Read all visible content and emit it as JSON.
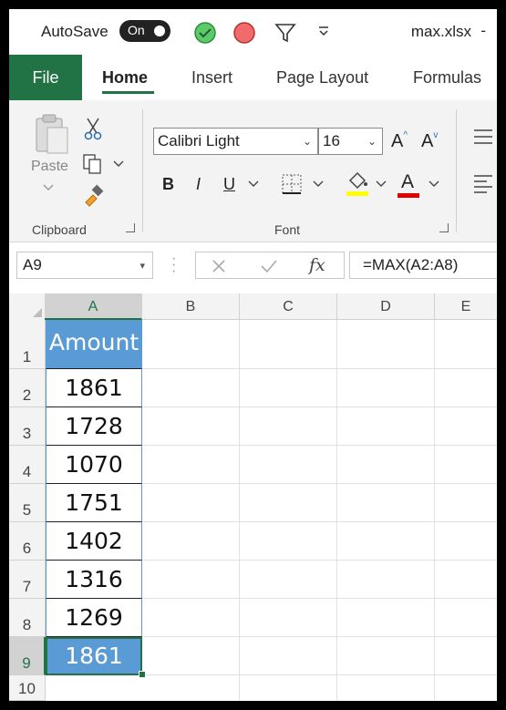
{
  "titlebar": {
    "autosave_label": "AutoSave",
    "autosave_state": "On",
    "filename": "max.xlsx",
    "dash": "-",
    "icons": [
      "check-circle-icon",
      "red-circle-icon",
      "filter-icon",
      "customize-caret-icon"
    ]
  },
  "tabs": [
    {
      "label": "File"
    },
    {
      "label": "Home"
    },
    {
      "label": "Insert"
    },
    {
      "label": "Page Layout"
    },
    {
      "label": "Formulas"
    }
  ],
  "ribbon": {
    "clipboard": {
      "label": "Clipboard",
      "paste_label": "Paste"
    },
    "font": {
      "label": "Font",
      "font_name": "Calibri Light",
      "font_size": "16",
      "bold": "B",
      "italic": "I",
      "underline": "U",
      "font_color_glyph": "A",
      "grow_glyph": "A",
      "shrink_glyph": "A",
      "highlight_color": "#ffff00",
      "font_color": "#e00000"
    }
  },
  "formula_bar": {
    "name_box": "A9",
    "formula": "=MAX(A2:A8)",
    "fx": "fx"
  },
  "sheet": {
    "columns": [
      "A",
      "B",
      "C",
      "D",
      "E"
    ],
    "rows": [
      "1",
      "2",
      "3",
      "4",
      "5",
      "6",
      "7",
      "8",
      "9",
      "10"
    ],
    "selected_column": "A",
    "selected_row": "9",
    "cells": {
      "A1": "Amount",
      "A2": "1861",
      "A3": "1728",
      "A4": "1070",
      "A5": "1751",
      "A6": "1402",
      "A7": "1316",
      "A8": "1269",
      "A9": "1861"
    },
    "accent_color": "#217346",
    "table_color": "#5b9bd5"
  }
}
